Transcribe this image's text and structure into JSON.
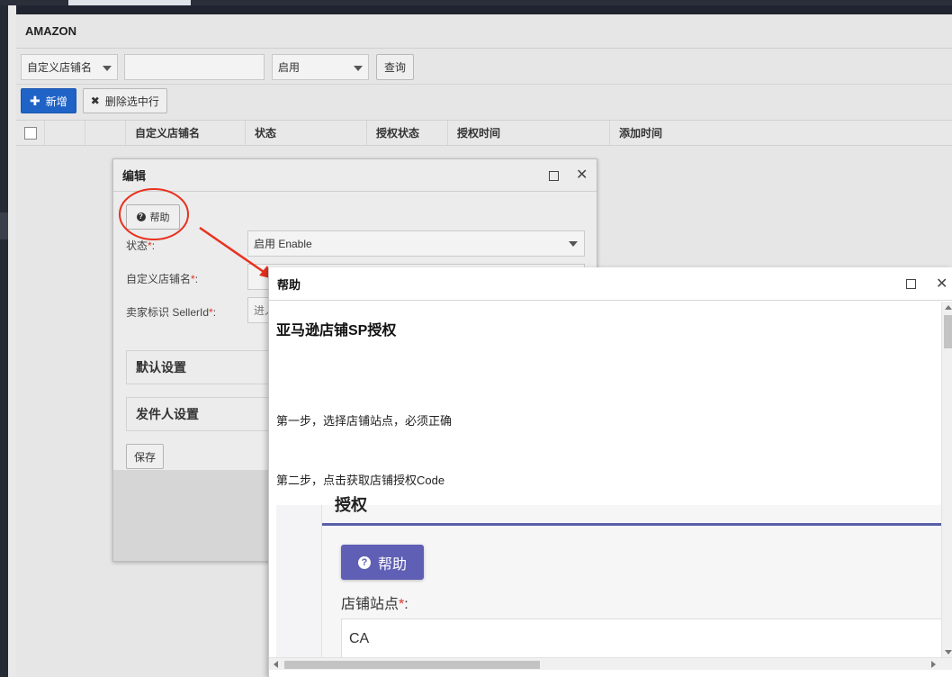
{
  "app": {
    "title": "AMAZON"
  },
  "filters": {
    "store_name_select": "自定义店铺名",
    "search_value": "",
    "status_select": "启用",
    "query_label": "查询"
  },
  "toolbar": {
    "add_label": "新增",
    "delete_label": "删除选中行"
  },
  "grid": {
    "columns": [
      "自定义店铺名",
      "状态",
      "授权状态",
      "授权时间",
      "添加时间"
    ]
  },
  "edit_dialog": {
    "title": "编辑",
    "help_label": "帮助",
    "fields": [
      {
        "label": "状态",
        "value": "启用 Enable"
      },
      {
        "label": "自定义店铺名",
        "value": ""
      },
      {
        "label": "卖家标识 SellerId",
        "placeholder": "进入"
      }
    ],
    "sections": [
      "默认设置",
      "发件人设置"
    ],
    "save_label": "保存"
  },
  "help_dialog": {
    "title": "帮助",
    "heading": "亚马逊店铺SP授权",
    "steps": [
      "第一步，选择店铺站点，必须正确",
      "第二步，点击获取店铺授权Code"
    ],
    "embedded": {
      "cut_title": "授权",
      "help_label": "帮助",
      "site_label": "店铺站点",
      "site_value": "CA"
    }
  },
  "colors": {
    "primary_button": "#1f63c7",
    "help_button": "#5f5fb5",
    "annotation": "#e8321f",
    "required_mark": "#d32222"
  }
}
